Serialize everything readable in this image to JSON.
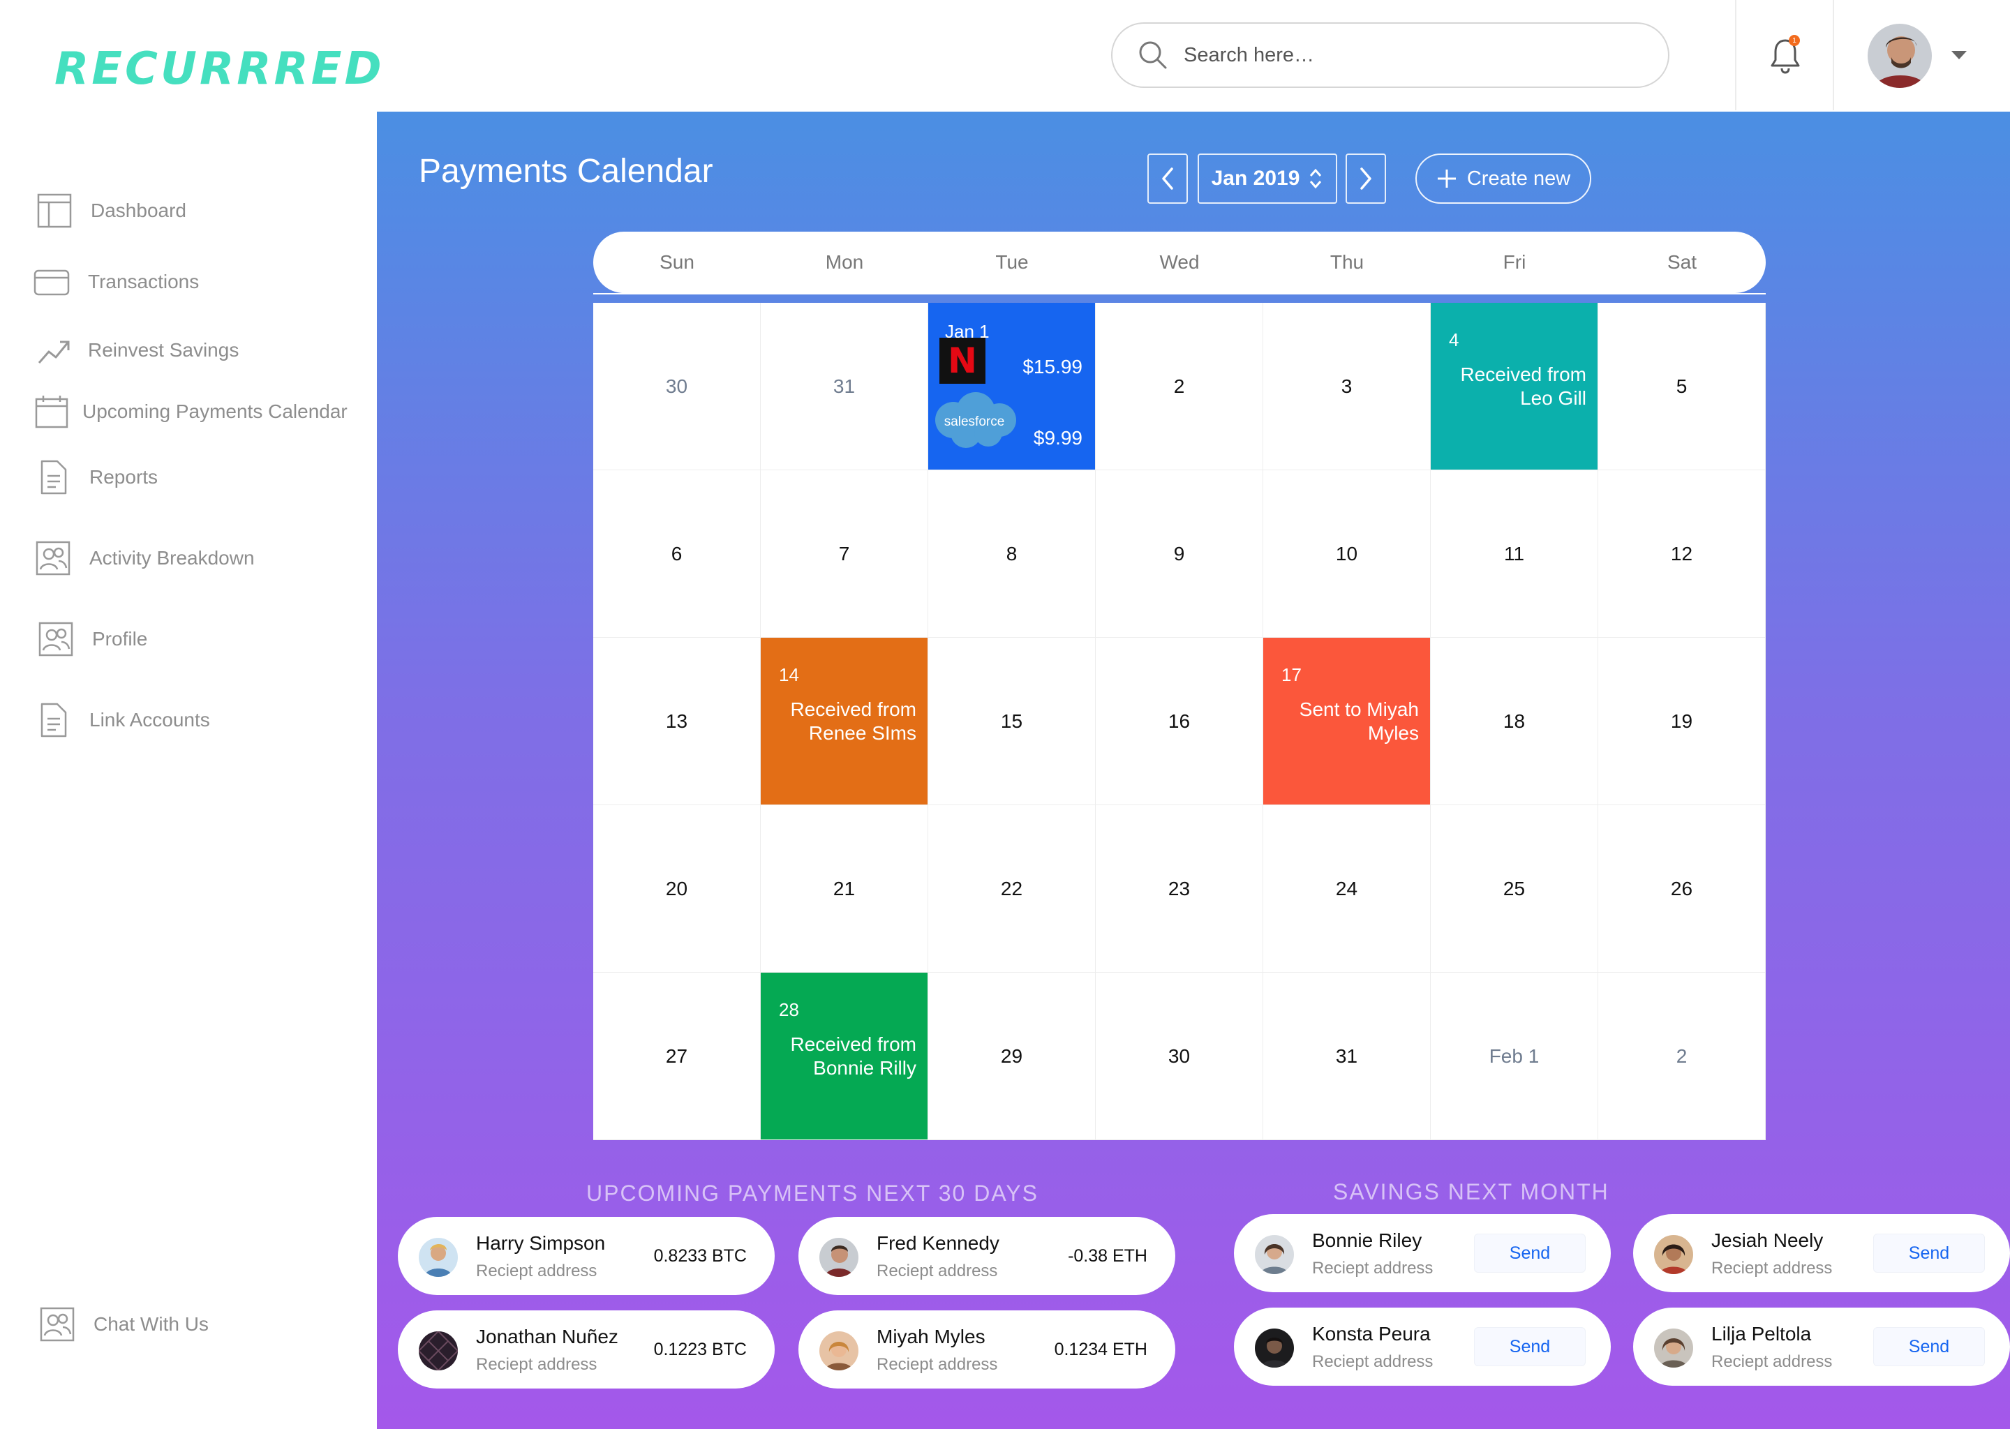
{
  "app": {
    "logo": "RECURRRED"
  },
  "header": {
    "search_placeholder": "Search here…",
    "notification_count": "1"
  },
  "sidebar": {
    "items": [
      {
        "label": "Dashboard",
        "icon": "dashboard-icon"
      },
      {
        "label": "Transactions",
        "icon": "card-icon"
      },
      {
        "label": "Reinvest Savings",
        "icon": "trend-up-icon"
      },
      {
        "label": "Upcoming Payments Calendar",
        "icon": "calendar-icon"
      },
      {
        "label": "Reports",
        "icon": "document-icon"
      },
      {
        "label": "Activity Breakdown",
        "icon": "users-icon"
      },
      {
        "label": "Profile",
        "icon": "users-icon"
      },
      {
        "label": "Link Accounts",
        "icon": "document-icon"
      }
    ],
    "chat": {
      "label": "Chat With Us",
      "icon": "users-icon"
    }
  },
  "main": {
    "title": "Payments Calendar",
    "month": "Jan 2019",
    "create_label": "Create new"
  },
  "calendar": {
    "weekdays": [
      "Sun",
      "Mon",
      "Tue",
      "Wed",
      "Thu",
      "Fri",
      "Sat"
    ],
    "days": [
      "30",
      "31",
      "Jan 1",
      "2",
      "3",
      "4",
      "5",
      "6",
      "7",
      "8",
      "9",
      "10",
      "11",
      "12",
      "13",
      "14",
      "15",
      "16",
      "17",
      "18",
      "19",
      "20",
      "21",
      "22",
      "23",
      "24",
      "25",
      "26",
      "27",
      "28",
      "29",
      "30",
      "31",
      "Feb 1",
      "2"
    ],
    "events": {
      "jan1": {
        "day": "Jan 1",
        "netflix_amount": "$15.99",
        "salesforce_amount": "$9.99",
        "salesforce_logo_text": "salesforce"
      },
      "jan4": {
        "day": "4",
        "line1": "Received from",
        "line2": "Leo Gill"
      },
      "jan14": {
        "day": "14",
        "line1": "Received from",
        "line2": "Renee SIms"
      },
      "jan17": {
        "day": "17",
        "line1": "Sent to Miyah",
        "line2": "Myles"
      },
      "jan28": {
        "day": "28",
        "line1": "Received from",
        "line2": "Bonnie Rilly"
      }
    }
  },
  "upcoming": {
    "title": "UPCOMING PAYMENTS NEXT 30 DAYS",
    "items": [
      {
        "name": "Harry Simpson",
        "sub": "Reciept address",
        "amount": "0.8233 BTC"
      },
      {
        "name": "Fred Kennedy",
        "sub": "Reciept address",
        "amount": "-0.38 ETH"
      },
      {
        "name": "Jonathan Nuñez",
        "sub": "Reciept address",
        "amount": "0.1223 BTC"
      },
      {
        "name": "Miyah Myles",
        "sub": "Reciept address",
        "amount": "0.1234 ETH"
      }
    ]
  },
  "savings": {
    "title": "SAVINGS NEXT MONTH",
    "items": [
      {
        "name": "Bonnie Riley",
        "sub": "Reciept address",
        "action": "Send"
      },
      {
        "name": "Jesiah Neely",
        "sub": "Reciept address",
        "action": "Send"
      },
      {
        "name": "Konsta Peura",
        "sub": "Reciept address",
        "action": "Send"
      },
      {
        "name": "Lilja Peltola",
        "sub": "Reciept address",
        "action": "Send"
      }
    ]
  },
  "colors": {
    "brand": "#45dfbf",
    "event_blue": "#1665f0",
    "event_teal": "#0bb0ac",
    "event_orange": "#e36e16",
    "event_red": "#fb573b",
    "event_green": "#05a953",
    "gradient_top": "#4b8fe3",
    "gradient_bottom": "#a458ea"
  }
}
